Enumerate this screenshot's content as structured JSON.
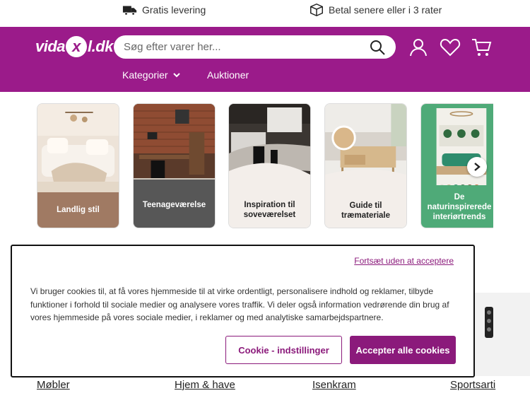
{
  "promo": {
    "delivery": "Gratis levering",
    "payment": "Betal senere eller i 3 rater"
  },
  "header": {
    "logo_left": "vida",
    "logo_x": "x",
    "logo_right": "l.dk",
    "search_placeholder": "Søg efter varer her...",
    "nav": {
      "categories": "Kategorier",
      "auctions": "Auktioner"
    }
  },
  "cards": [
    {
      "label": "Landlig stil",
      "label_bg": "#a07a63",
      "label_color": "#ffffff"
    },
    {
      "label": "Teenageværelse",
      "label_bg": "#575757",
      "label_color": "#ffffff"
    },
    {
      "label": "Inspiration til soveværelset",
      "label_bg": "#f3eeea",
      "label_color": "#222222"
    },
    {
      "label": "Guide til træmateriale",
      "label_bg": "#f3eeea",
      "label_color": "#222222"
    },
    {
      "label": "De naturinspirerede interiørtrends",
      "label_bg": "#4faa78",
      "label_color": "#ffffff"
    }
  ],
  "cookie": {
    "skip_link": "Fortsæt uden at acceptere",
    "text": "Vi bruger cookies til, at få vores hjemmeside til at virke ordentligt, personalisere indhold og reklamer, tilbyde funktioner i forhold til sociale medier og analysere vores traffik. Vi deler også information vedrørende din brug af vores hjemmeside på vores sociale medier, i reklamer og med analytiske samarbejdspartnere.",
    "settings_button": "Cookie - indstillinger",
    "accept_button": "Accepter alle cookies"
  },
  "bottom_links": [
    "Møbler",
    "Hjem & have",
    "Isenkram",
    "Sportsarti"
  ],
  "colors": {
    "brand": "#9b1b8a",
    "accent": "#8b1a7b"
  }
}
